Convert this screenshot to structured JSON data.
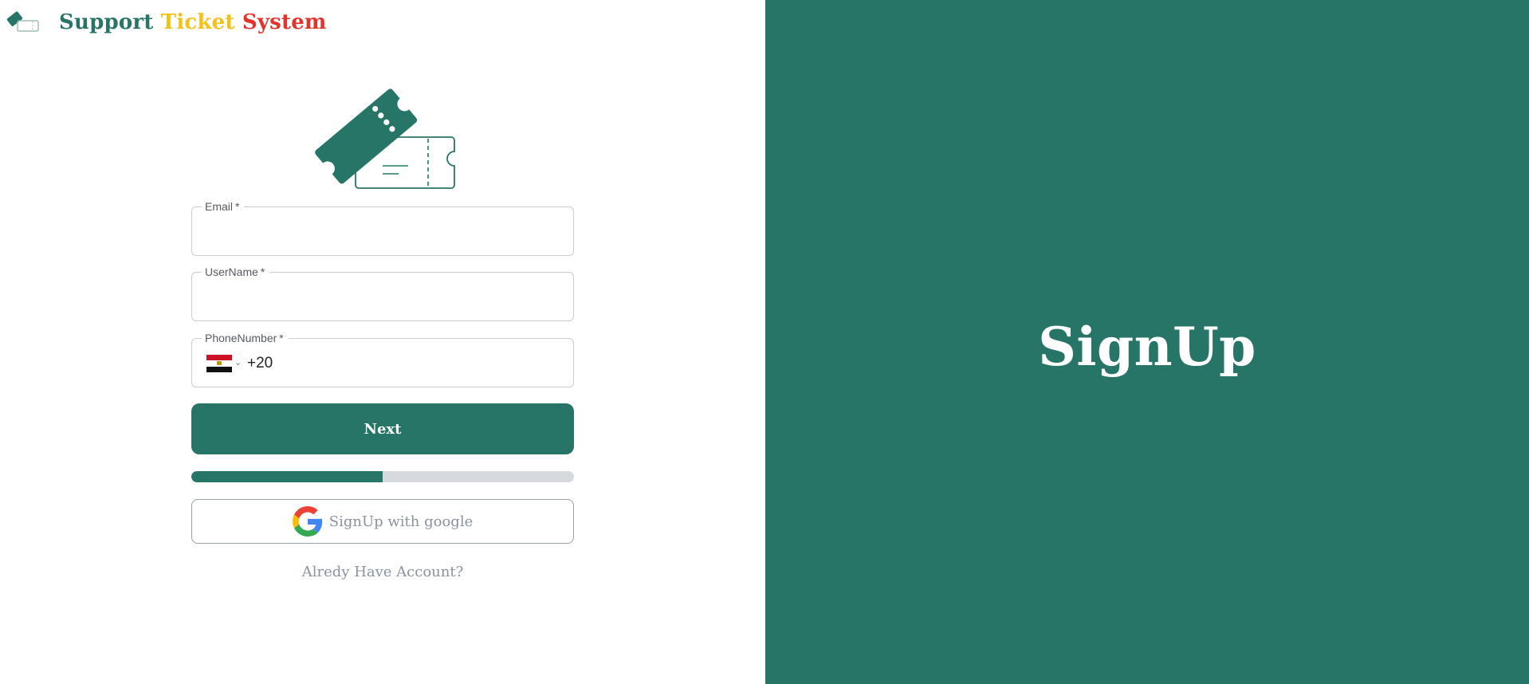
{
  "app": {
    "title_parts": [
      "Support",
      "Ticket",
      "System"
    ]
  },
  "form": {
    "email": {
      "label": "Email",
      "required_mark": "*",
      "value": ""
    },
    "username": {
      "label": "UserName",
      "required_mark": "*",
      "value": ""
    },
    "phone": {
      "label": "PhoneNumber",
      "required_mark": "*",
      "country_code": "+20",
      "flag": "egypt-flag-icon"
    },
    "next_label": "Next",
    "progress_percent": 50,
    "google_label": "SignUp with google",
    "login_link": "Alredy Have Account?"
  },
  "side_panel": {
    "title": "SignUp"
  },
  "colors": {
    "primary": "#277567",
    "brand_yellow": "#f4c01a",
    "brand_red": "#e3342c",
    "muted_text": "#8a93a0",
    "progress_track": "#d6d9de"
  },
  "icons": {
    "brand": "ticket-logo-icon",
    "hero": "tickets-illustration-icon",
    "google": "google-icon",
    "caret": "chevron-down-icon"
  }
}
